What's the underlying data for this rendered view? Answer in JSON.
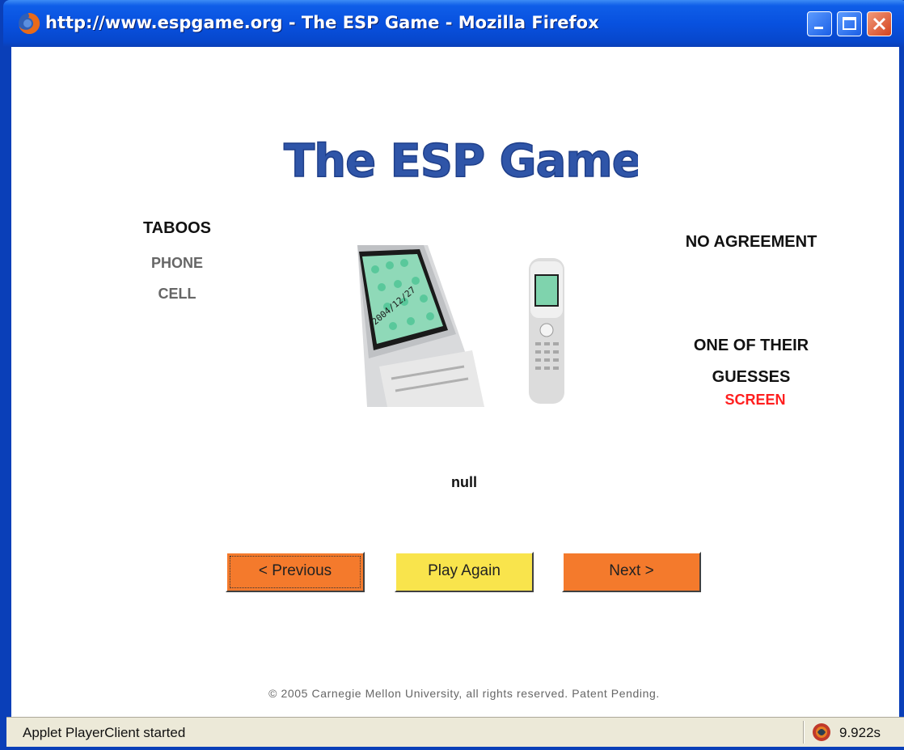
{
  "window": {
    "title": "http://www.espgame.org - The ESP Game - Mozilla Firefox",
    "icon": "firefox-icon"
  },
  "game": {
    "logo_text": "The ESP Game",
    "taboos": {
      "heading": "TABOOS",
      "words": [
        "PHONE",
        "CELL"
      ]
    },
    "agreement_status": "NO AGREEMENT",
    "partner_guess": {
      "heading_line1": "ONE OF THEIR",
      "heading_line2": "GUESSES",
      "word": "SCREEN",
      "word_color": "#ff1f1f"
    },
    "image_subject": "flip-phone-photo",
    "result_text": "null"
  },
  "buttons": {
    "previous": "< Previous",
    "play_again": "Play Again",
    "next": "Next >",
    "orange": "#f47a2c",
    "yellow": "#f9e44c"
  },
  "footer": {
    "copyright": "© 2005 Carnegie Mellon University, all rights reserved. Patent Pending."
  },
  "statusbar": {
    "message": "Applet PlayerClient started",
    "timer": "9.922s",
    "icon": "java-applet-icon"
  }
}
